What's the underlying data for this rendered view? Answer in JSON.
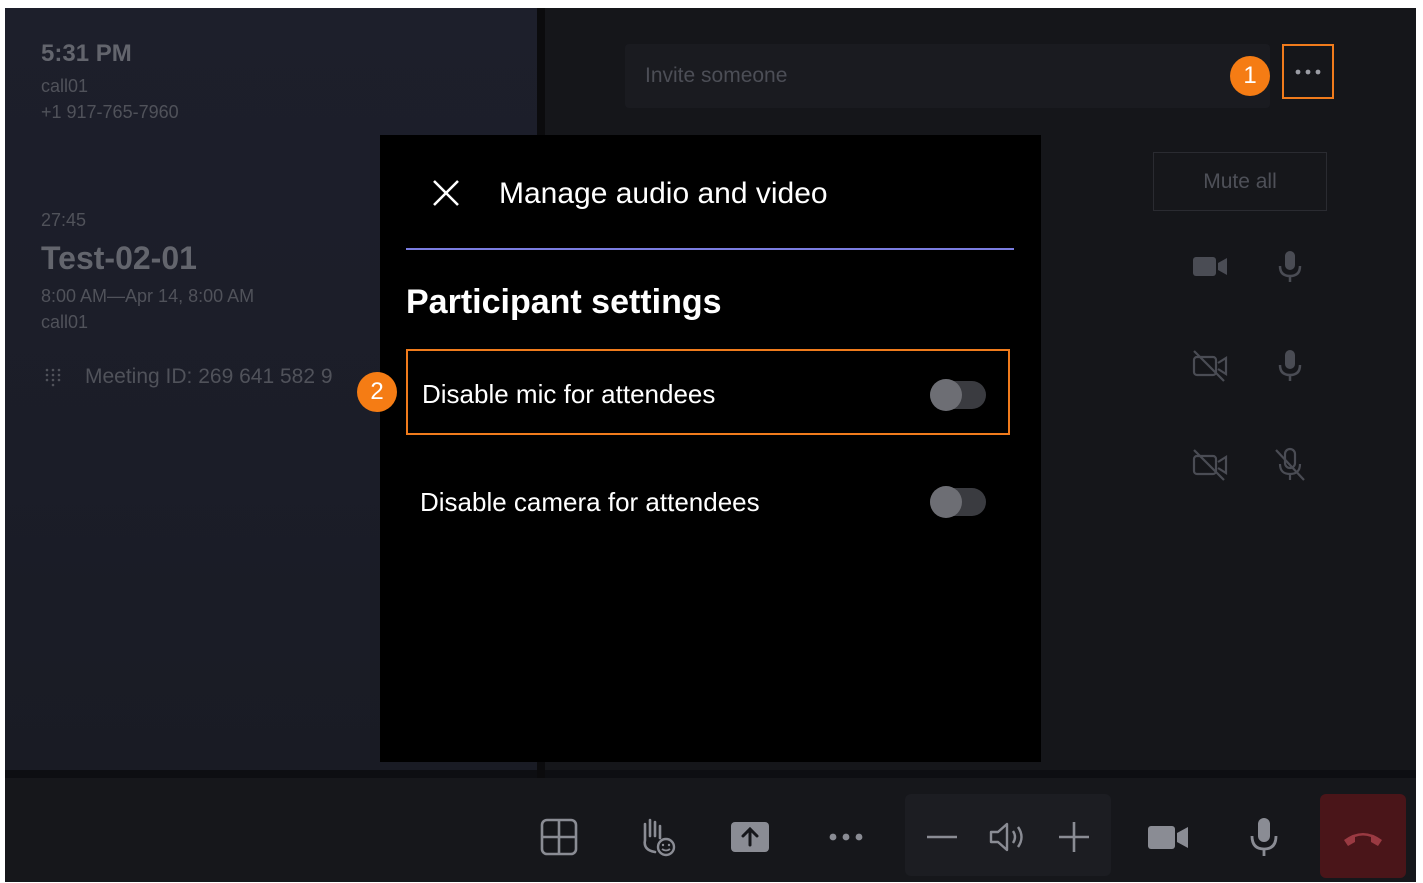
{
  "left_panel": {
    "clock": "5:31 PM",
    "device_name": "call01",
    "phone": "+1 917-765-7960",
    "duration": "27:45",
    "meeting_title": "Test-02-01",
    "meeting_time": "8:00 AM—Apr 14, 8:00 AM",
    "organizer": "call01",
    "meeting_id_label": "Meeting ID:",
    "meeting_id_value": "269 641 582 9"
  },
  "right_panel": {
    "invite_placeholder": "Invite someone",
    "more_label": "•••",
    "mute_all_label": "Mute all",
    "participants": [
      {
        "video": "video-on",
        "mic": "mic-on"
      },
      {
        "video": "video-off",
        "mic": "mic-on"
      },
      {
        "video": "video-off",
        "mic": "mic-off"
      }
    ]
  },
  "dialog": {
    "title": "Manage audio and video",
    "section_title": "Participant settings",
    "settings": [
      {
        "label": "Disable mic for attendees",
        "enabled": false,
        "highlighted": true
      },
      {
        "label": "Disable camera for attendees",
        "enabled": false,
        "highlighted": false
      }
    ]
  },
  "callouts": [
    {
      "number": "1",
      "color": "#f57c14"
    },
    {
      "number": "2",
      "color": "#f57c14"
    }
  ],
  "bottom_bar": {
    "icons": [
      "layout-icon",
      "raise-hand-icon",
      "share-icon",
      "more-icon",
      "volume-down-icon",
      "speaker-icon",
      "volume-up-icon",
      "camera-icon",
      "mic-icon",
      "hang-up-icon"
    ]
  },
  "colors": {
    "accent_highlight": "#f07b1c",
    "rule_accent": "#7b7de0",
    "hangup": "#4a1519"
  }
}
